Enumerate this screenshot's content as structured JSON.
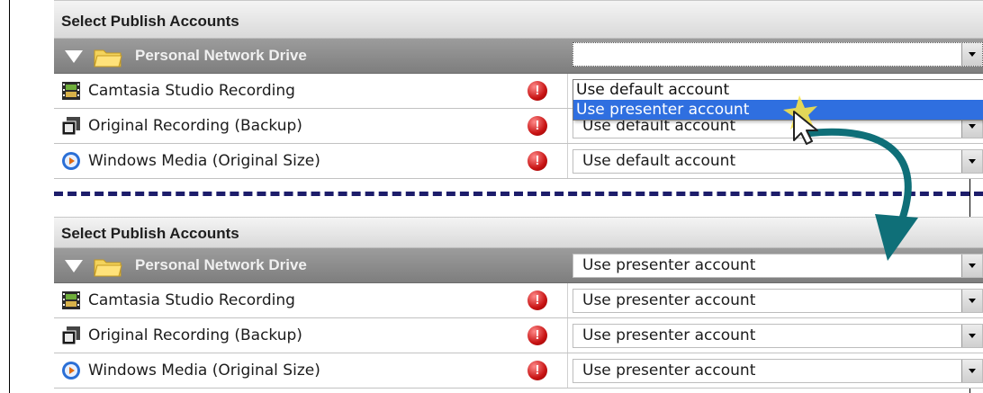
{
  "panels": {
    "top": {
      "header": "Select Publish Accounts",
      "group": {
        "name": "Personal Network Drive",
        "account": ""
      },
      "items": [
        {
          "label": "Camtasia Studio Recording",
          "account": ""
        },
        {
          "label": "Original Recording (Backup)",
          "account": "Use default account"
        },
        {
          "label": "Windows Media (Original Size)",
          "account": "Use default account"
        }
      ]
    },
    "bottom": {
      "header": "Select Publish Accounts",
      "group": {
        "name": "Personal Network Drive",
        "account": "Use presenter account"
      },
      "items": [
        {
          "label": "Camtasia Studio Recording",
          "account": "Use presenter account"
        },
        {
          "label": "Original Recording (Backup)",
          "account": "Use presenter account"
        },
        {
          "label": "Windows Media (Original Size)",
          "account": "Use presenter account"
        }
      ]
    }
  },
  "dropdown": {
    "options": [
      "Use default account",
      "Use presenter account"
    ],
    "selected_index": 1
  },
  "warning_glyph": "!",
  "colors": {
    "selection": "#2f6fe0",
    "divider": "#1d1d6b",
    "arrow": "#0f6f78",
    "warning": "#c81414"
  },
  "icons": {
    "group": [
      "expand-triangle-icon",
      "folder-icon"
    ],
    "items": [
      "film-icon",
      "film-stack-icon",
      "windows-media-icon"
    ],
    "status": "warning-icon",
    "select": "dropdown-arrow-icon"
  }
}
